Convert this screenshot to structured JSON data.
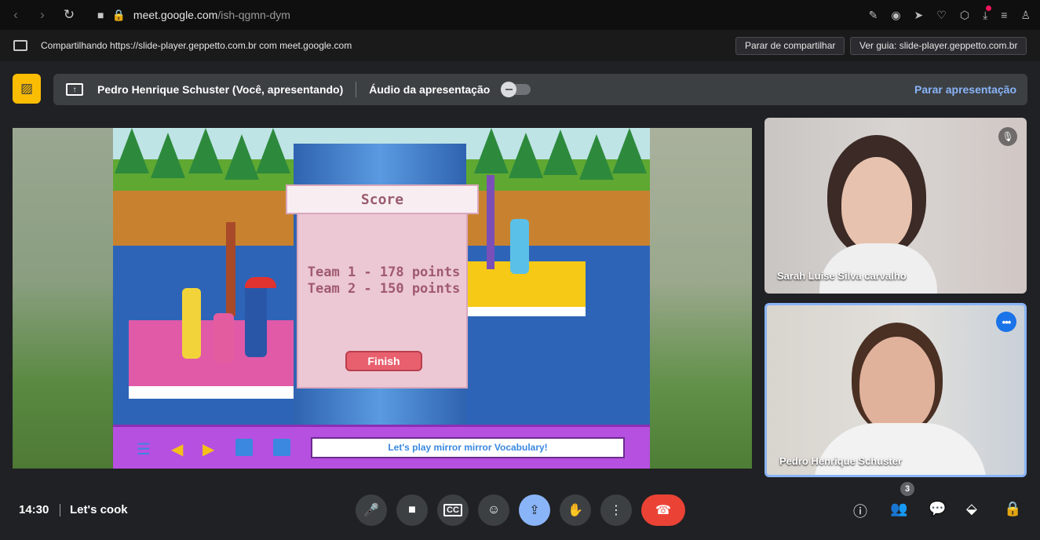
{
  "browser": {
    "url_host": "meet.google.com",
    "url_path": "/ish-qgmn-dym"
  },
  "share": {
    "text": "Compartilhando https://slide-player.geppetto.com.br com meet.google.com",
    "stop_label": "Parar de compartilhar",
    "view_label": "Ver guia: slide-player.geppetto.com.br"
  },
  "presenting": {
    "who": "Pedro Henrique Schuster (Você, apresentando)",
    "audio_label": "Áudio da apresentação",
    "audio_on": false,
    "stop_label": "Parar apresentação"
  },
  "game": {
    "score_title": "Score",
    "team1": "Team 1 - 178 points",
    "team2": "Team 2 - 150 points",
    "finish_label": "Finish",
    "activity_title": "Let's play mirror mirror Vocabulary!"
  },
  "participants": [
    {
      "name": "Sarah Luise Silva carvalho",
      "muted": true
    },
    {
      "name": "Pedro Henrique Schuster",
      "active": true
    }
  ],
  "meeting": {
    "time": "14:30",
    "title": "Let's cook",
    "participant_count": "3"
  },
  "colors": {
    "accent": "#8ab4f8",
    "end_call": "#ea4335",
    "warning": "#fbbc04"
  }
}
